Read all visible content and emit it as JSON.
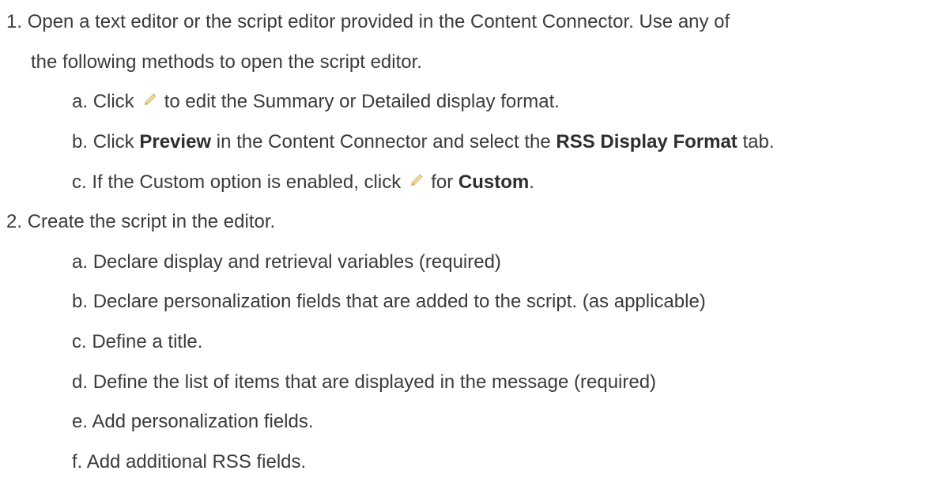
{
  "steps": [
    {
      "number": "1.",
      "line1": "Open a text editor or the script editor provided in the Content Connector. Use any of",
      "line2": "the following methods to open the script editor.",
      "substeps": [
        {
          "letter": "a.",
          "before_icon": "Click",
          "icon": "pencil-edit-icon",
          "after_icon": "to edit the Summary or Detailed display format."
        },
        {
          "letter": "b.",
          "text_1": "Click",
          "bold_1": "Preview",
          "text_2": "in the Content Connector and select the",
          "bold_2": "RSS Display Format",
          "text_3": "tab."
        },
        {
          "letter": "c.",
          "before_icon": "If the Custom option is enabled, click",
          "icon": "pencil-edit-icon",
          "after_icon": "for",
          "bold": "Custom",
          "end": "."
        }
      ]
    },
    {
      "number": "2.",
      "line1": "Create the script in the editor.",
      "substeps": [
        {
          "letter": "a.",
          "text": "Declare display and retrieval variables (required)"
        },
        {
          "letter": "b.",
          "text": "Declare personalization fields that are added to the script. (as applicable)"
        },
        {
          "letter": "c.",
          "text": "Define a title."
        },
        {
          "letter": "d.",
          "text": "Define the list of items that are displayed in the message (required)"
        },
        {
          "letter": "e.",
          "text": "Add personalization fields."
        },
        {
          "letter": "f.",
          "text": "Add additional RSS fields."
        }
      ]
    }
  ],
  "colors": {
    "text": "#3b3b3b",
    "pencil_body": "#e8d89a",
    "pencil_tip": "#c9a85a"
  }
}
